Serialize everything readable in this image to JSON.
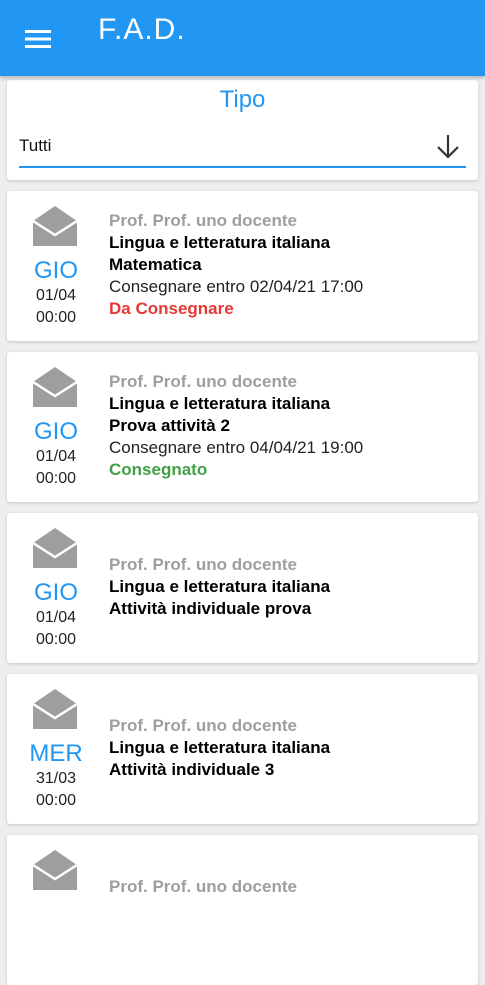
{
  "header": {
    "title": "F.A.D.",
    "menu_icon": "hamburger-menu-icon"
  },
  "filter": {
    "label": "Tipo",
    "selected": "Tutti",
    "arrow_icon": "arrow-down-icon"
  },
  "colors": {
    "primary": "#2196f3",
    "status_pending": "#e53935",
    "status_done": "#43a047",
    "teacher": "#9e9e9e",
    "envelope": "#9e9e9e"
  },
  "items": [
    {
      "day": "GIO",
      "date": "01/04",
      "time": "00:00",
      "teacher": "Prof. Prof. uno docente",
      "subject": "Lingua e letteratura italiana",
      "activity": "Matematica",
      "deadline": "Consegnare entro 02/04/21 17:00",
      "status": "Da Consegnare",
      "status_color": "#e53935",
      "icon": "envelope-open-icon"
    },
    {
      "day": "GIO",
      "date": "01/04",
      "time": "00:00",
      "teacher": "Prof. Prof. uno docente",
      "subject": "Lingua e letteratura italiana",
      "activity": "Prova attività 2",
      "deadline": "Consegnare entro 04/04/21 19:00",
      "status": "Consegnato",
      "status_color": "#43a047",
      "icon": "envelope-open-icon"
    },
    {
      "day": "GIO",
      "date": "01/04",
      "time": "00:00",
      "teacher": "Prof. Prof. uno docente",
      "subject": "Lingua e letteratura italiana",
      "activity": "Attività individuale prova",
      "icon": "envelope-open-icon"
    },
    {
      "day": "MER",
      "date": "31/03",
      "time": "00:00",
      "teacher": "Prof. Prof. uno docente",
      "subject": "Lingua e letteratura italiana",
      "activity": "Attività individuale 3",
      "icon": "envelope-open-icon"
    },
    {
      "teacher": "Prof. Prof. uno docente",
      "icon": "envelope-open-icon"
    }
  ]
}
